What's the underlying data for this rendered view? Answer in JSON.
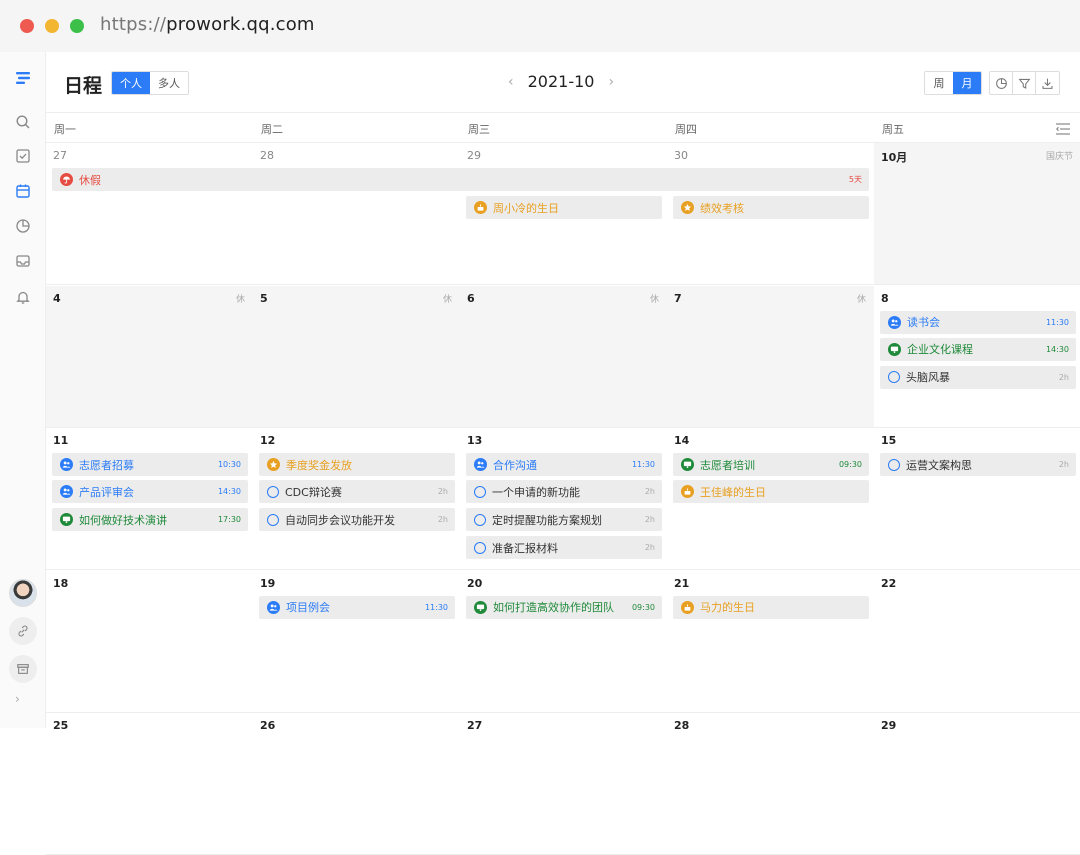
{
  "browser": {
    "url_proto": "https://",
    "url_host": "prowork.qq.com"
  },
  "header": {
    "title": "日程",
    "scope_tabs": [
      "个人",
      "多人"
    ],
    "scope_active": 0,
    "prev": "‹",
    "next": "›",
    "month": "2021-10",
    "view_tabs": [
      "周",
      "月"
    ],
    "view_active": 1
  },
  "weekdays": [
    "周一",
    "周二",
    "周三",
    "周四",
    "周五"
  ],
  "colors": {
    "blue": "#2b7cf6",
    "green": "#1f8a3a",
    "orange": "#e8a022",
    "red": "#e54d42",
    "accent": "#2b7cf6"
  },
  "weeks": [
    {
      "days": [
        {
          "num": "27",
          "gray": false
        },
        {
          "num": "28",
          "gray": false
        },
        {
          "num": "29",
          "gray": false
        },
        {
          "num": "30",
          "gray": false
        },
        {
          "num": "10月",
          "gray": true,
          "current": true,
          "holiday": "国庆节"
        }
      ]
    },
    {
      "days": [
        {
          "num": "4",
          "gray": true,
          "current": true,
          "off": "休"
        },
        {
          "num": "5",
          "gray": true,
          "current": true,
          "off": "休"
        },
        {
          "num": "6",
          "gray": true,
          "current": true,
          "off": "休"
        },
        {
          "num": "7",
          "gray": true,
          "current": true,
          "off": "休"
        },
        {
          "num": "8",
          "gray": false,
          "current": true
        }
      ]
    },
    {
      "days": [
        {
          "num": "11",
          "current": true
        },
        {
          "num": "12",
          "current": true
        },
        {
          "num": "13",
          "current": true
        },
        {
          "num": "14",
          "current": true
        },
        {
          "num": "15",
          "current": true
        }
      ]
    },
    {
      "days": [
        {
          "num": "18",
          "current": true
        },
        {
          "num": "19",
          "current": true
        },
        {
          "num": "20",
          "current": true
        },
        {
          "num": "21",
          "current": true
        },
        {
          "num": "22",
          "current": true
        }
      ]
    },
    {
      "days": [
        {
          "num": "25",
          "current": true
        },
        {
          "num": "26",
          "current": true
        },
        {
          "num": "27",
          "current": true
        },
        {
          "num": "28",
          "current": true
        },
        {
          "num": "29",
          "current": true
        }
      ]
    }
  ],
  "events": [
    {
      "week": 0,
      "day": 0,
      "span": 4,
      "slot": 0,
      "title": "休假",
      "icon": "umbrella-icon",
      "color": "red",
      "time": "5天"
    },
    {
      "week": 0,
      "day": 2,
      "span": 1,
      "slot": 1,
      "title": "周小冷的生日",
      "icon": "cake-icon",
      "color": "orange",
      "time": ""
    },
    {
      "week": 0,
      "day": 3,
      "span": 1,
      "slot": 1,
      "title": "绩效考核",
      "icon": "star-icon",
      "color": "orange",
      "time": ""
    },
    {
      "week": 1,
      "day": 4,
      "span": 1,
      "slot": 0,
      "title": "读书会",
      "icon": "people-icon",
      "color": "blue",
      "time": "11:30"
    },
    {
      "week": 1,
      "day": 4,
      "span": 1,
      "slot": 1,
      "title": "企业文化课程",
      "icon": "screen-icon",
      "color": "green",
      "time": "14:30"
    },
    {
      "week": 1,
      "day": 4,
      "span": 1,
      "slot": 2,
      "title": "头脑风暴",
      "icon": "todo-ring-icon",
      "color": "blue",
      "time": "2h",
      "plain": true
    },
    {
      "week": 2,
      "day": 0,
      "span": 1,
      "slot": 0,
      "title": "志愿者招募",
      "icon": "people-icon",
      "color": "blue",
      "time": "10:30"
    },
    {
      "week": 2,
      "day": 0,
      "span": 1,
      "slot": 1,
      "title": "产品评审会",
      "icon": "people-icon",
      "color": "blue",
      "time": "14:30"
    },
    {
      "week": 2,
      "day": 0,
      "span": 1,
      "slot": 2,
      "title": "如何做好技术演讲",
      "icon": "screen-icon",
      "color": "green",
      "time": "17:30"
    },
    {
      "week": 2,
      "day": 1,
      "span": 1,
      "slot": 0,
      "title": "季度奖金发放",
      "icon": "star-icon",
      "color": "orange",
      "time": ""
    },
    {
      "week": 2,
      "day": 1,
      "span": 1,
      "slot": 1,
      "title": "CDC辩论赛",
      "icon": "todo-ring-icon",
      "color": "blue",
      "time": "2h",
      "plain": true
    },
    {
      "week": 2,
      "day": 1,
      "span": 1,
      "slot": 2,
      "title": "自动同步会议功能开发",
      "icon": "todo-ring-icon",
      "color": "blue",
      "time": "2h",
      "plain": true
    },
    {
      "week": 2,
      "day": 2,
      "span": 1,
      "slot": 0,
      "title": "合作沟通",
      "icon": "people-icon",
      "color": "blue",
      "time": "11:30"
    },
    {
      "week": 2,
      "day": 2,
      "span": 1,
      "slot": 1,
      "title": "一个申请的新功能",
      "icon": "todo-ring-icon",
      "color": "blue",
      "time": "2h",
      "plain": true
    },
    {
      "week": 2,
      "day": 2,
      "span": 1,
      "slot": 2,
      "title": "定时提醒功能方案规划",
      "icon": "todo-ring-icon",
      "color": "blue",
      "time": "2h",
      "plain": true
    },
    {
      "week": 2,
      "day": 2,
      "span": 1,
      "slot": 3,
      "title": "准备汇报材料",
      "icon": "todo-ring-icon",
      "color": "blue",
      "time": "2h",
      "plain": true
    },
    {
      "week": 2,
      "day": 3,
      "span": 1,
      "slot": 0,
      "title": "志愿者培训",
      "icon": "screen-icon",
      "color": "green",
      "time": "09:30"
    },
    {
      "week": 2,
      "day": 3,
      "span": 1,
      "slot": 1,
      "title": "王佳峰的生日",
      "icon": "cake-icon",
      "color": "orange",
      "time": ""
    },
    {
      "week": 2,
      "day": 4,
      "span": 1,
      "slot": 0,
      "title": "运营文案构思",
      "icon": "todo-ring-icon",
      "color": "blue",
      "time": "2h",
      "plain": true
    },
    {
      "week": 3,
      "day": 1,
      "span": 1,
      "slot": 0,
      "title": "项目例会",
      "icon": "people-icon",
      "color": "blue",
      "time": "11:30"
    },
    {
      "week": 3,
      "day": 2,
      "span": 1,
      "slot": 0,
      "title": "如何打造高效协作的团队",
      "icon": "screen-icon",
      "color": "green",
      "time": "09:30"
    },
    {
      "week": 3,
      "day": 3,
      "span": 1,
      "slot": 0,
      "title": "马力的生日",
      "icon": "cake-icon",
      "color": "orange",
      "time": ""
    }
  ]
}
